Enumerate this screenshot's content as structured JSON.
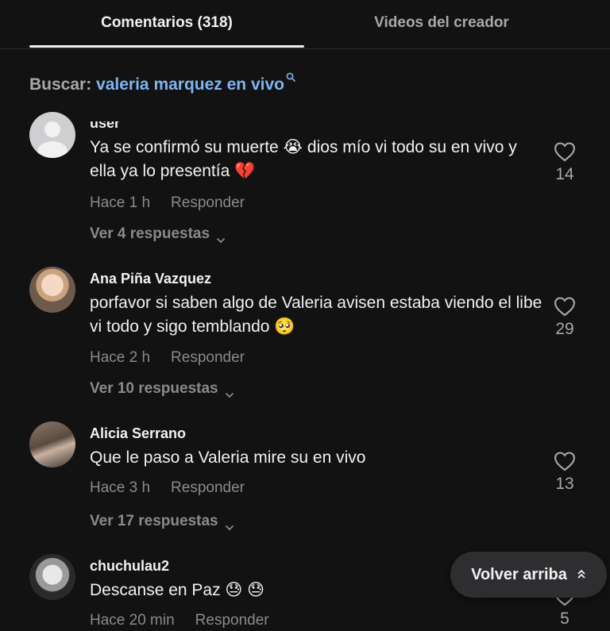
{
  "tabs": {
    "comments": "Comentarios (318)",
    "creator_videos": "Videos del creador"
  },
  "search": {
    "label": "Buscar:",
    "query": "valeria marquez en vivo"
  },
  "comments": [
    {
      "username": "user",
      "text": "Ya se confirmó su muerte 😭 dios mío vi todo su en vivo y ella ya lo presentía 💔",
      "time": "Hace 1 h",
      "reply_label": "Responder",
      "replies_label": "Ver 4 respuestas",
      "likes": "14",
      "avatar": "default-avatar"
    },
    {
      "username": "Ana Piña Vazquez",
      "text": "porfavor si saben algo de Valeria avisen estaba viendo el libe vi todo y sigo temblando 🥺",
      "time": "Hace 2 h",
      "reply_label": "Responder",
      "replies_label": "Ver 10 respuestas",
      "likes": "29",
      "avatar": "photo-avatar"
    },
    {
      "username": "Alicia Serrano",
      "text": "Que le paso a Valeria mire su en vivo",
      "time": "Hace 3 h",
      "reply_label": "Responder",
      "replies_label": "Ver 17 respuestas",
      "likes": "13",
      "avatar": "photo-avatar"
    },
    {
      "username": "chuchulau2",
      "text": "Descanse en Paz 😓 😓",
      "time": "Hace 20 min",
      "reply_label": "Responder",
      "likes": "5",
      "avatar": "photo-avatar"
    }
  ],
  "back_to_top": "Volver arriba",
  "colors": {
    "background": "#121212",
    "link": "#7fb4f0",
    "muted": "#8a8a8d"
  }
}
